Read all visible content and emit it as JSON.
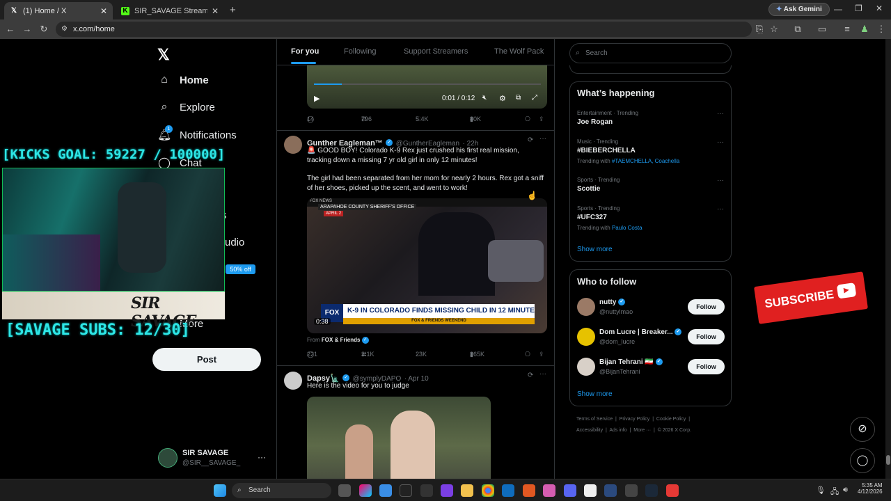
{
  "browser": {
    "tabs": [
      {
        "label": "(1) Home / X",
        "active": true
      },
      {
        "label": "SIR_SAVAGE Stream - Watch Liv",
        "active": false
      }
    ],
    "new_tab": "+",
    "url": "x.com/home",
    "gemini": "Ask Gemini"
  },
  "nav": {
    "items": [
      {
        "label": "Home",
        "icon": "home-icon"
      },
      {
        "label": "Explore",
        "icon": "search-icon"
      },
      {
        "label": "Notifications",
        "icon": "bell-icon"
      },
      {
        "label": "Chat",
        "icon": "chat-icon"
      }
    ],
    "notif_count": "1",
    "hidden_tail_1": "s",
    "hidden_tail_2": "udio",
    "more": "More",
    "badge": "50% off",
    "post": "Post",
    "account": {
      "name": "SIR SAVAGE",
      "handle": "@SIR__SAVAGE_"
    }
  },
  "overlay": {
    "kicks_goal": "[KICKS GOAL: 59227 / 100000]",
    "subs_goal": "[SAVAGE SUBS: 12/30]",
    "logo": "SIR SAVAGE",
    "subscribe": "SUBSCRIBE"
  },
  "feed": {
    "tabs": [
      "For you",
      "Following",
      "Support Streamers",
      "The Wolf Pack"
    ],
    "video1": {
      "time": "0:01 / 0:12"
    },
    "tweet1_stats": {
      "replies": "14",
      "reposts": "796",
      "likes": "5.4K",
      "views": "80K"
    },
    "tweet2": {
      "name": "Gunther Eagleman™",
      "handle": "@GuntherEagleman",
      "time": "· 22h",
      "line1": "🚨 GOOD BOY! Colorado K-9 Rex just crushed his first real mission, tracking down a missing 7 yr old girl in only 12 minutes!",
      "line2": "The girl had been separated from her mom for nearly 2 hours. Rex got a sniff of her shoes, picked up the scent, and went to work!",
      "video_banner": "K-9 IN COLORADO FINDS MISSING CHILD IN 12 MINUTES",
      "video_sub": "FOX & FRIENDS WEEKEND",
      "sheriff": "ARAPAHOE COUNTY SHERIFF'S OFFICE",
      "date_tag": "APRIL 2",
      "network": "FOX NEWS",
      "duration": "0:38",
      "from_label": "From",
      "from_source": "FOX & Friends",
      "stats": {
        "replies": "221",
        "reposts": "3.1K",
        "likes": "23K",
        "views": "265K"
      }
    },
    "tweet3": {
      "name": "Dapsy🗽",
      "handle": "@symplyDAPO",
      "time": "· Apr 10",
      "text": "Here is the video for you to judge"
    }
  },
  "right": {
    "search_placeholder": "Search",
    "happening": {
      "title": "What’s happening",
      "trends": [
        {
          "meta": "Entertainment · Trending",
          "name": "Joe Rogan",
          "with": ""
        },
        {
          "meta": "Music · Trending",
          "name": "#BIEBERCHELLA",
          "with": "Trending with",
          "links": "#TAEMCHELLA, Coachella"
        },
        {
          "meta": "Sports · Trending",
          "name": "Scottie",
          "with": ""
        },
        {
          "meta": "Sports · Trending",
          "name": "#UFC327",
          "with": "Trending with",
          "links": "Paulo Costa"
        }
      ],
      "show_more": "Show more"
    },
    "who_to_follow": {
      "title": "Who to follow",
      "accounts": [
        {
          "name": "nutty",
          "handle": "@nuttylmao"
        },
        {
          "name": "Dom Lucre | Breaker...",
          "handle": "@dom_lucre"
        },
        {
          "name": "Bijan Tehrani 🇮🇷",
          "handle": "@BijanTehrani"
        }
      ],
      "follow_label": "Follow",
      "show_more": "Show more"
    },
    "footer": {
      "row1": [
        "Terms of Service",
        "Privacy Policy",
        "Cookie Policy"
      ],
      "row2": [
        "Accessibility",
        "Ads info",
        "More ···",
        "© 2026 X Corp."
      ]
    }
  },
  "taskbar": {
    "search": "Search",
    "time": "5:35 AM",
    "date": "4/12/2026"
  },
  "colors": {
    "accent": "#1d9bf0",
    "overlay_cyan": "#2ee6e6",
    "subscribe_red": "#e02020"
  }
}
